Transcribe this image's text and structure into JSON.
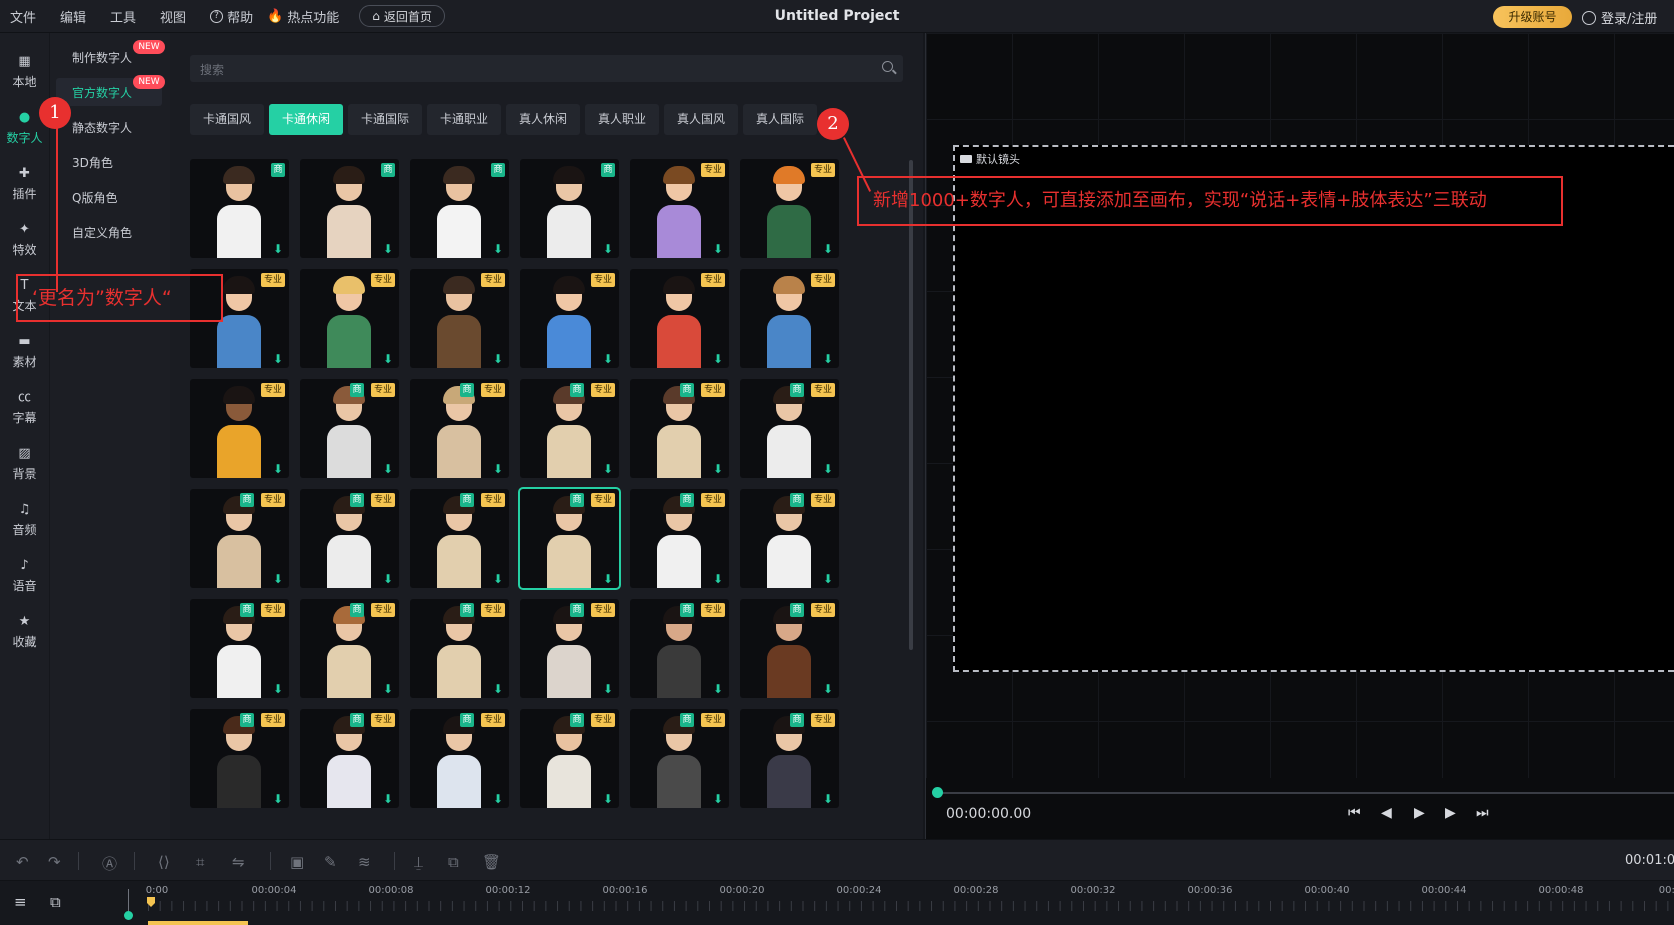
{
  "topbar": {
    "menu": [
      "文件",
      "编辑",
      "工具",
      "视图"
    ],
    "help": "帮助",
    "hot": "热点功能",
    "home": "返回首页",
    "project_title": "Untitled Project",
    "upgrade": "升级账号",
    "login": "登录/注册"
  },
  "leftnav": [
    {
      "label": "本地",
      "icon": "film-icon"
    },
    {
      "label": "数字人",
      "icon": "person-icon",
      "active": true
    },
    {
      "label": "插件",
      "icon": "puzzle-icon"
    },
    {
      "label": "特效",
      "icon": "sparkle-icon"
    },
    {
      "label": "文本",
      "icon": "text-icon"
    },
    {
      "label": "素材",
      "icon": "folder-icon"
    },
    {
      "label": "字幕",
      "icon": "cc-icon"
    },
    {
      "label": "背景",
      "icon": "background-icon"
    },
    {
      "label": "音频",
      "icon": "music-icon"
    },
    {
      "label": "语音",
      "icon": "voice-icon"
    },
    {
      "label": "收藏",
      "icon": "star-icon"
    }
  ],
  "subnav": [
    {
      "label": "制作数字人",
      "badge": "NEW"
    },
    {
      "label": "官方数字人",
      "badge": "NEW",
      "active": true
    },
    {
      "label": "静态数字人"
    },
    {
      "label": "3D角色"
    },
    {
      "label": "Q版角色"
    },
    {
      "label": "自定义角色"
    }
  ],
  "search": {
    "placeholder": "搜索"
  },
  "tabs": [
    {
      "label": "卡通国风"
    },
    {
      "label": "卡通休闲",
      "active": true
    },
    {
      "label": "卡通国际"
    },
    {
      "label": "卡通职业"
    },
    {
      "label": "真人休闲"
    },
    {
      "label": "真人职业"
    },
    {
      "label": "真人国风"
    },
    {
      "label": "真人国际"
    }
  ],
  "badges": {
    "pro": "专业",
    "biz": "商"
  },
  "grid": [
    {
      "biz": true,
      "pro": false,
      "hair": "#3b2a20",
      "body": "#f1f1f1",
      "skin": "#e9c2a0"
    },
    {
      "biz": true,
      "pro": false,
      "hair": "#2a1d16",
      "body": "#e6d3c0",
      "skin": "#eac6a6"
    },
    {
      "biz": true,
      "pro": false,
      "hair": "#3b2a20",
      "body": "#f3f3f3",
      "skin": "#e9c2a0"
    },
    {
      "biz": true,
      "pro": false,
      "hair": "#1a1413",
      "body": "#ececec",
      "skin": "#eac6a6"
    },
    {
      "biz": false,
      "pro": true,
      "hair": "#7a4a22",
      "body": "#a88ad8",
      "skin": "#f0c7a5"
    },
    {
      "biz": false,
      "pro": true,
      "hair": "#e07a28",
      "body": "#2f6b45",
      "skin": "#f0c7a5"
    },
    {
      "biz": false,
      "pro": true,
      "hair": "#1a1413",
      "body": "#4a86c8",
      "skin": "#f0c7a5"
    },
    {
      "biz": false,
      "pro": true,
      "hair": "#e9c06a",
      "body": "#3f8a5a",
      "skin": "#f0c7a5"
    },
    {
      "biz": false,
      "pro": true,
      "hair": "#3b2a20",
      "body": "#6a4a2f",
      "skin": "#e9c2a0"
    },
    {
      "biz": false,
      "pro": true,
      "hair": "#1a1413",
      "body": "#4a8ad8",
      "skin": "#f0c7a5"
    },
    {
      "biz": false,
      "pro": true,
      "hair": "#1a1413",
      "body": "#d94a3a",
      "skin": "#f0c7a5"
    },
    {
      "biz": false,
      "pro": true,
      "hair": "#b9824a",
      "body": "#4a86c8",
      "skin": "#f0c7a5"
    },
    {
      "biz": false,
      "pro": true,
      "hair": "#1a1413",
      "body": "#e9a42a",
      "skin": "#8a5a3a"
    },
    {
      "biz": true,
      "pro": true,
      "hair": "#8a5a3a",
      "body": "#dcdcdc",
      "skin": "#eac6a6"
    },
    {
      "biz": true,
      "pro": true,
      "hair": "#c8a878",
      "body": "#d8c0a0",
      "skin": "#eac6a6"
    },
    {
      "biz": true,
      "pro": true,
      "hair": "#5a3a2a",
      "body": "#e2cfae",
      "skin": "#eac6a6"
    },
    {
      "biz": true,
      "pro": true,
      "hair": "#5a3a2a",
      "body": "#e2cfae",
      "skin": "#eac6a6"
    },
    {
      "biz": true,
      "pro": true,
      "hair": "#2a1d16",
      "body": "#ececec",
      "skin": "#eac6a6"
    },
    {
      "biz": true,
      "pro": true,
      "hair": "#2a1d16",
      "body": "#d8c0a0",
      "skin": "#eac6a6"
    },
    {
      "biz": true,
      "pro": true,
      "hair": "#2a1d16",
      "body": "#ececec",
      "skin": "#eac6a6"
    },
    {
      "biz": true,
      "pro": true,
      "hair": "#2a1d16",
      "body": "#e2cfae",
      "skin": "#eac6a6"
    },
    {
      "biz": true,
      "pro": true,
      "hair": "#2a1d16",
      "body": "#e2cfae",
      "skin": "#eac6a6",
      "selected": true
    },
    {
      "biz": true,
      "pro": true,
      "hair": "#2a1d16",
      "body": "#f0f0f0",
      "skin": "#eac6a6"
    },
    {
      "biz": true,
      "pro": true,
      "hair": "#2a1d16",
      "body": "#f0f0f0",
      "skin": "#eac6a6"
    },
    {
      "biz": true,
      "pro": true,
      "hair": "#2a1d16",
      "body": "#f0f0f0",
      "skin": "#eac6a6"
    },
    {
      "biz": true,
      "pro": true,
      "hair": "#a86a3a",
      "body": "#e2cfae",
      "skin": "#eac6a6"
    },
    {
      "biz": true,
      "pro": true,
      "hair": "#2a1d16",
      "body": "#e2cfae",
      "skin": "#eac6a6"
    },
    {
      "biz": true,
      "pro": true,
      "hair": "#1a1413",
      "body": "#dcd4cc",
      "skin": "#eac6a6"
    },
    {
      "biz": true,
      "pro": true,
      "hair": "#1a1413",
      "body": "#3a3a3a",
      "skin": "#d8a888"
    },
    {
      "biz": true,
      "pro": true,
      "hair": "#1a1413",
      "body": "#6a3a22",
      "skin": "#d8a888"
    },
    {
      "biz": true,
      "pro": true,
      "hair": "#4a2a1a",
      "body": "#2a2a2a",
      "skin": "#eac6a6"
    },
    {
      "biz": true,
      "pro": true,
      "hair": "#2a1d16",
      "body": "#e6e6ee",
      "skin": "#eac6a6"
    },
    {
      "biz": true,
      "pro": true,
      "hair": "#1a1413",
      "body": "#dde4ee",
      "skin": "#eac6a6"
    },
    {
      "biz": true,
      "pro": true,
      "hair": "#2a1d16",
      "body": "#e8e4dc",
      "skin": "#e9c2a0"
    },
    {
      "biz": true,
      "pro": true,
      "hair": "#2a1d16",
      "body": "#4a4a4a",
      "skin": "#eac6a6"
    },
    {
      "biz": true,
      "pro": true,
      "hair": "#1a1413",
      "body": "#3a3a48",
      "skin": "#eac6a6"
    }
  ],
  "preview": {
    "camera_label": "默认镜头",
    "time": "00:00:00.00"
  },
  "toolbar": {
    "duration": "00:01:0"
  },
  "timeline": {
    "ticks": [
      "0:00",
      "00:00:04",
      "00:00:08",
      "00:00:12",
      "00:00:16",
      "00:00:20",
      "00:00:24",
      "00:00:28",
      "00:00:32",
      "00:00:36",
      "00:00:40",
      "00:00:44",
      "00:00:48",
      "00:00:5"
    ]
  },
  "annotations": {
    "n1": "1",
    "n2": "2",
    "rename": "‘更名为”数字人“",
    "desc": "新增1000+数字人，可直接添加至画布，实现“说话+表情+肢体表达”三联动"
  },
  "colors": {
    "accent": "#25d0a4",
    "annotation": "#e8302f",
    "pro_badge": "#f5c451",
    "new_badge": "#ff4d5a"
  }
}
